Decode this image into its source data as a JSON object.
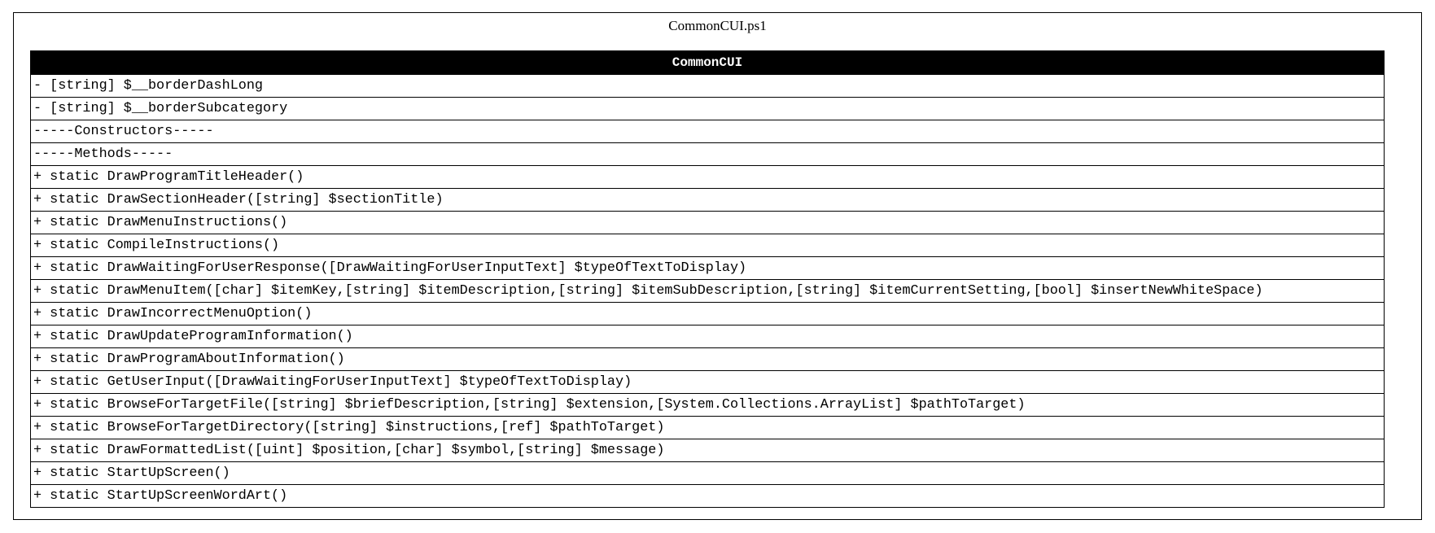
{
  "package": {
    "title": "CommonCUI.ps1"
  },
  "class": {
    "name": "CommonCUI",
    "members": [
      "- [string] $__borderDashLong",
      "- [string] $__borderSubcategory",
      "-----Constructors-----",
      "-----Methods-----",
      "+ static DrawProgramTitleHeader()",
      "+ static DrawSectionHeader([string] $sectionTitle)",
      "+ static DrawMenuInstructions()",
      "+ static CompileInstructions()",
      "+ static DrawWaitingForUserResponse([DrawWaitingForUserInputText] $typeOfTextToDisplay)",
      "+ static DrawMenuItem([char] $itemKey,[string] $itemDescription,[string] $itemSubDescription,[string] $itemCurrentSetting,[bool] $insertNewWhiteSpace)",
      "+ static DrawIncorrectMenuOption()",
      "+ static DrawUpdateProgramInformation()",
      "+ static DrawProgramAboutInformation()",
      "+ static GetUserInput([DrawWaitingForUserInputText] $typeOfTextToDisplay)",
      "+ static BrowseForTargetFile([string] $briefDescription,[string] $extension,[System.Collections.ArrayList] $pathToTarget)",
      "+ static BrowseForTargetDirectory([string] $instructions,[ref] $pathToTarget)",
      "+ static DrawFormattedList([uint] $position,[char] $symbol,[string] $message)",
      "+ static StartUpScreen()",
      "+ static StartUpScreenWordArt()"
    ]
  },
  "colors": {
    "header_background": "#000000",
    "header_text": "#ffffff",
    "border": "#000000",
    "background": "#ffffff"
  }
}
